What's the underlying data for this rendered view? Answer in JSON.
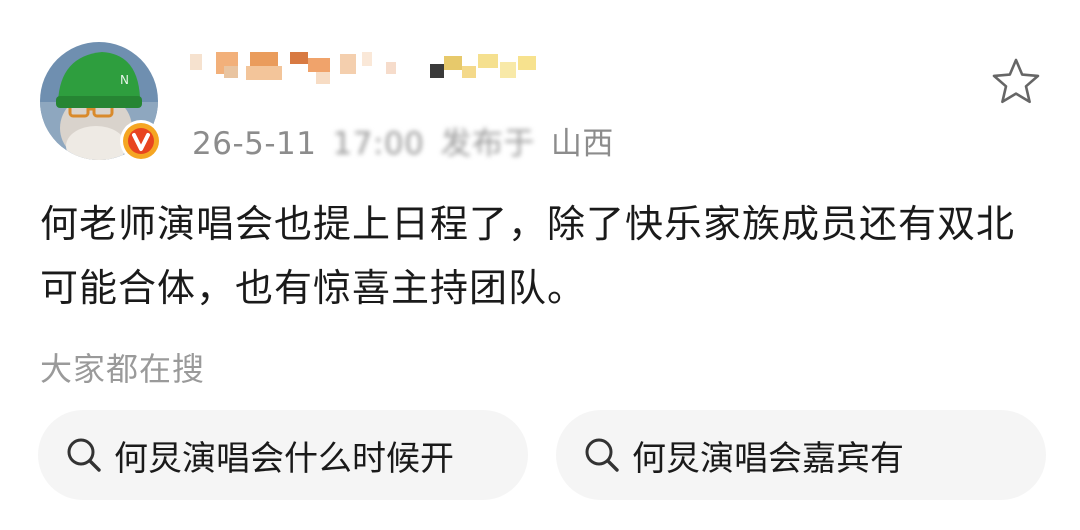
{
  "post": {
    "meta": {
      "date_visible": "26-5-11",
      "time_obscured": "17:00",
      "publish_prefix": "发布于",
      "location": "山西"
    },
    "text": "何老师演唱会也提上日程了，除了快乐家族成员还有双北可能合体，也有惊喜主持团队。"
  },
  "search_section": {
    "heading": "大家都在搜",
    "suggestions": [
      {
        "label": "何炅演唱会什么时候开",
        "icon": "search-icon"
      },
      {
        "label": "何炅演唱会嘉宾有",
        "icon": "search-icon"
      }
    ]
  },
  "actions": {
    "favorite_icon": "star-outline-icon"
  },
  "colors": {
    "text_primary": "#1a1a1a",
    "text_secondary": "#8c8c8c",
    "chip_background": "#f5f5f5",
    "verified_badge": "#f5a623",
    "avatar_hat": "#2e9e3e"
  }
}
